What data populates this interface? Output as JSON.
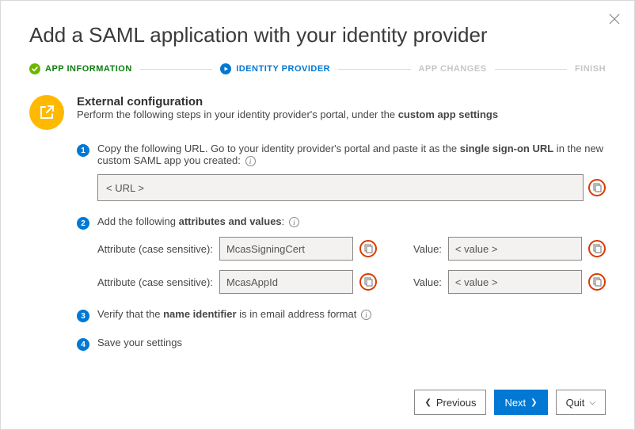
{
  "dialog": {
    "title": "Add a SAML application with your identity provider"
  },
  "stepper": {
    "step1": "APP INFORMATION",
    "step2": "IDENTITY PROVIDER",
    "step3": "APP CHANGES",
    "step4": "FINISH"
  },
  "section": {
    "heading": "External configuration",
    "subtext_before": "Perform the following steps in your identity provider's portal, under the ",
    "subtext_bold": "custom app settings"
  },
  "step1": {
    "text_a": "Copy the following URL. Go to your identity provider's portal and paste it as the ",
    "text_bold": "single sign-on URL",
    "text_b": " in the new custom SAML app you created: ",
    "url_value": "< URL >"
  },
  "step2": {
    "text_a": "Add the following ",
    "text_bold": "attributes and values",
    "text_b": ":",
    "attr_label": "Attribute (case sensitive):",
    "value_label": "Value:",
    "rows": [
      {
        "attr": "McasSigningCert",
        "val": "< value >"
      },
      {
        "attr": "McasAppId",
        "val": "< value >"
      }
    ]
  },
  "step3": {
    "text_a": "Verify that the ",
    "text_bold": "name identifier",
    "text_b": " is in email address format "
  },
  "step4": {
    "text": "Save your settings"
  },
  "footer": {
    "previous": "Previous",
    "next": "Next",
    "quit": "Quit"
  }
}
